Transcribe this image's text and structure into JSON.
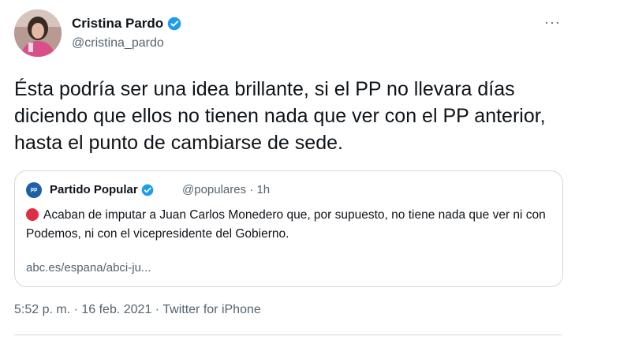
{
  "author": {
    "name": "Cristina Pardo",
    "handle": "@cristina_pardo",
    "verified_icon": "verified-badge-icon",
    "avatar_icon": "profile-photo"
  },
  "more_icon": "more-options-icon",
  "more_glyph": "···",
  "tweet_text": "Ésta podría ser una idea brillante, si el PP no llevara días diciendo que ellos no tienen nada que ver con el PP anterior, hasta el punto de cambiarse de sede.",
  "quote": {
    "avatar_text": "pp",
    "name": "Partido Popular",
    "handle_time": "@populares · 1h",
    "body": "Acaban de imputar a Juan Carlos Monedero que, por supuesto, no tiene nada que ver ni con Podemos, ni con el vicepresidente del Gobierno.",
    "link": "abc.es/espana/abci-ju..."
  },
  "timestamp_line": "5:52 p. m. · 16 feb. 2021 · Twitter for iPhone",
  "colors": {
    "verified": "#1d9bf0",
    "secondary_text": "#536471",
    "border": "#cfd9de",
    "red_dot": "#dd2e44",
    "pp_blue": "#1d60a8"
  }
}
